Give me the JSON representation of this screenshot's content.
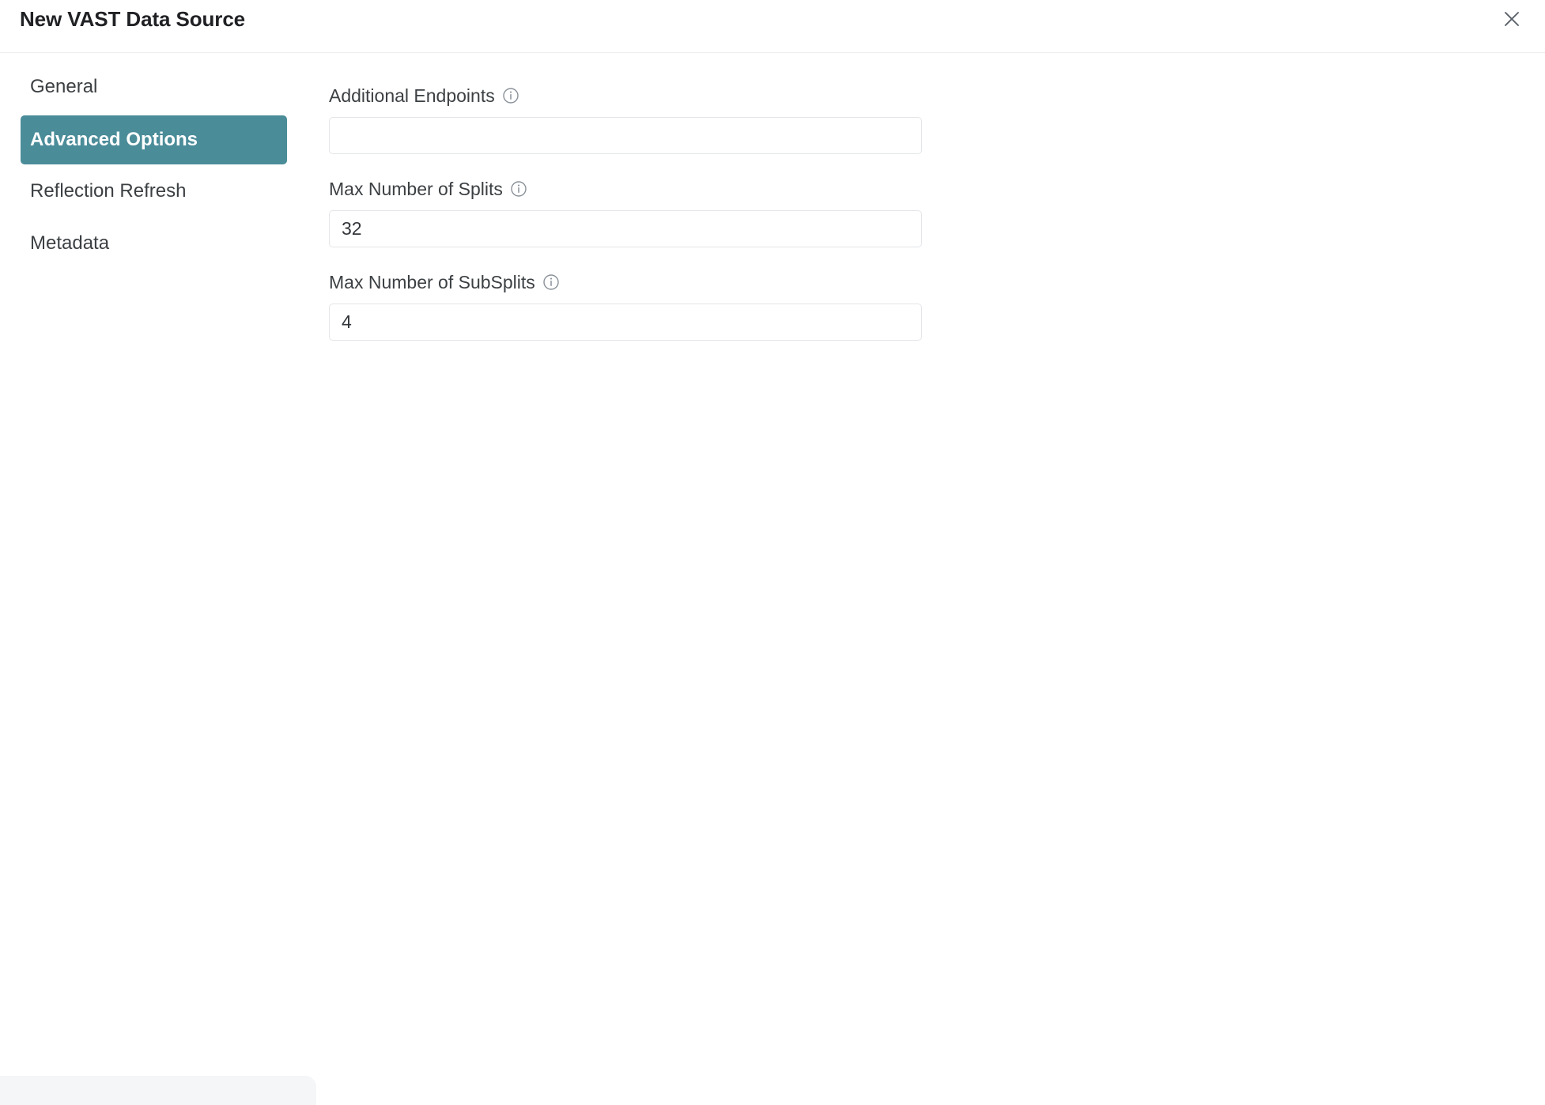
{
  "dialog": {
    "title": "New VAST Data Source",
    "close_label": "Close",
    "close_icon": "close-icon"
  },
  "sidebar": {
    "items": [
      {
        "label": "General",
        "selected": false
      },
      {
        "label": "Advanced Options",
        "selected": true
      },
      {
        "label": "Reflection Refresh",
        "selected": false
      },
      {
        "label": "Metadata",
        "selected": false
      }
    ]
  },
  "form": {
    "fields": [
      {
        "label": "Additional Endpoints",
        "value": "",
        "placeholder": "",
        "info_icon": "info-icon"
      },
      {
        "label": "Max Number of Splits",
        "value": "32",
        "placeholder": "",
        "info_icon": "info-icon"
      },
      {
        "label": "Max Number of SubSplits",
        "value": "4",
        "placeholder": "",
        "info_icon": "info-icon"
      }
    ]
  },
  "colors": {
    "accent_selected": "#4b8c99",
    "text_primary": "#202124",
    "text_secondary": "#3c4043",
    "border_input": "#e3e5e8",
    "divider": "#eceef0",
    "icon_gray": "#8a9199",
    "footer_strip": "#f5f6f7"
  }
}
